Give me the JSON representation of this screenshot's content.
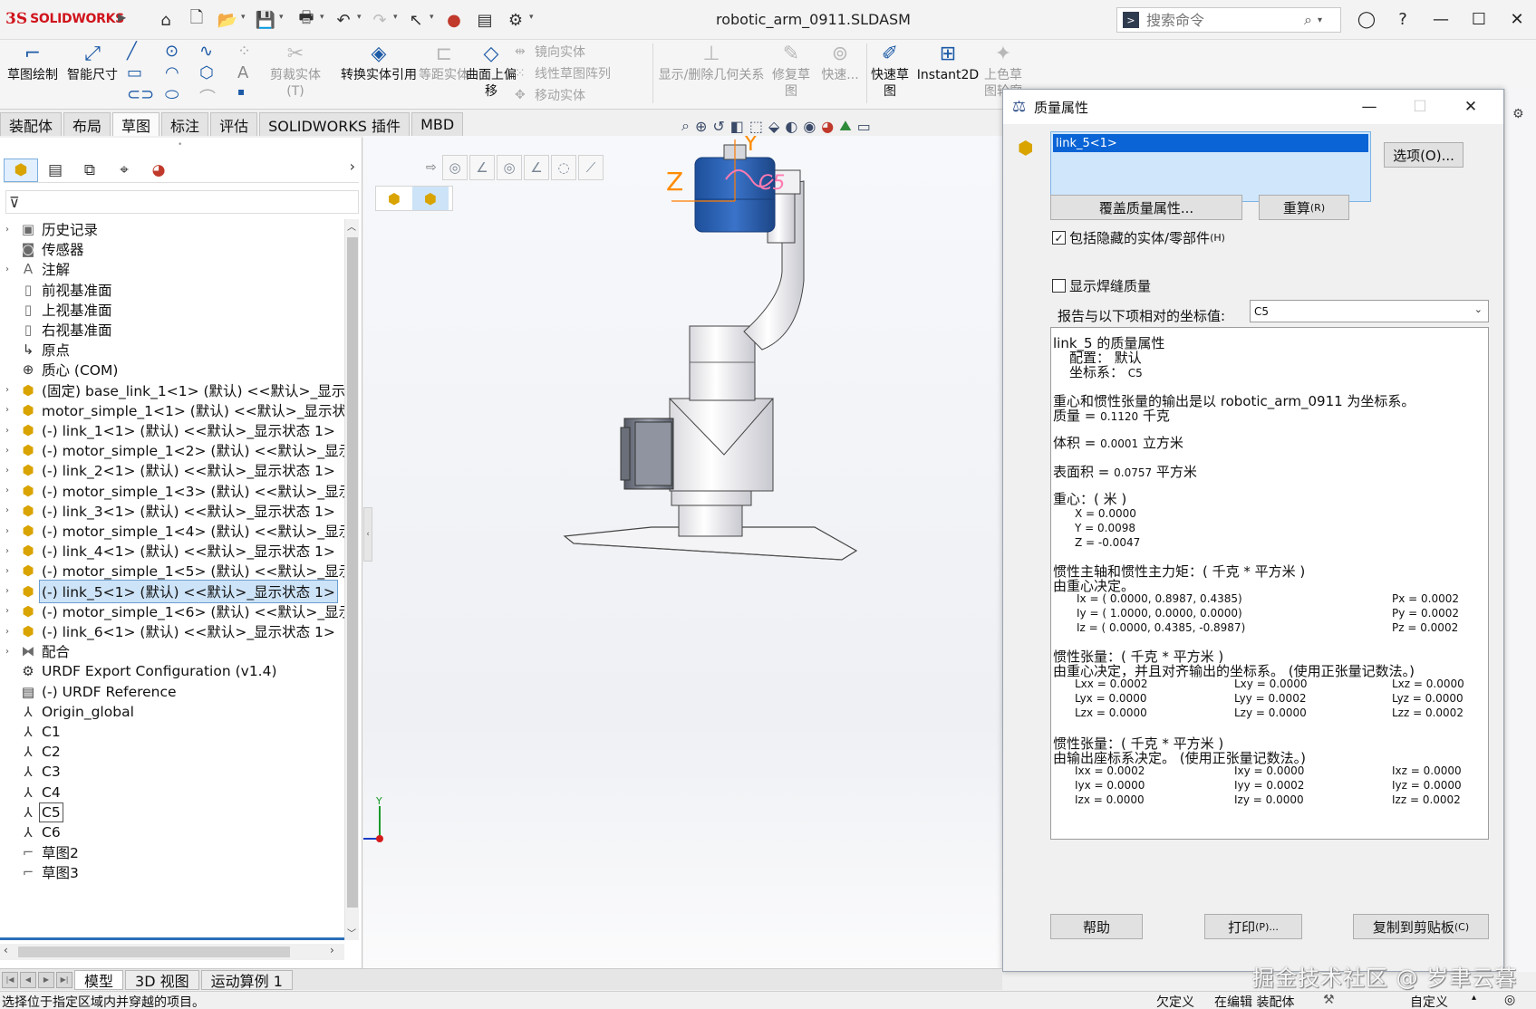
{
  "app": {
    "logo_prefix": "3S",
    "logo_text": "SOLIDWORKS",
    "document_title": "robotic_arm_0911.SLDASM",
    "search_placeholder": "搜索命令"
  },
  "ribbon": {
    "sketch": "草图绘制",
    "smart_dim": "智能尺寸",
    "trim": "剪裁实体(T)",
    "convert": "转换实体引用",
    "offset": "等距实体",
    "offset_surface": "曲面上偏移",
    "mirror": "镜向实体",
    "linear_pattern": "线性草图阵列",
    "move": "移动实体",
    "show_relations": "显示/删除几何关系",
    "repair": "修复草图",
    "quick_snaps": "快速...",
    "rapid_sketch": "快速草图",
    "instant2d": "Instant2D",
    "shaded_sketch": "上色草图轮廓"
  },
  "tabs": [
    "装配体",
    "布局",
    "草图",
    "标注",
    "评估",
    "SOLIDWORKS 插件",
    "MBD"
  ],
  "active_tab": "草图",
  "tree": [
    {
      "label": "历史记录",
      "exp": true,
      "icon": "history-icon"
    },
    {
      "label": "传感器",
      "exp": false,
      "icon": "sensor-icon"
    },
    {
      "label": "注解",
      "exp": true,
      "icon": "annotation-icon"
    },
    {
      "label": "前视基准面",
      "exp": false,
      "icon": "plane-icon"
    },
    {
      "label": "上视基准面",
      "exp": false,
      "icon": "plane-icon"
    },
    {
      "label": "右视基准面",
      "exp": false,
      "icon": "plane-icon"
    },
    {
      "label": "原点",
      "exp": false,
      "icon": "origin-icon"
    },
    {
      "label": "质心 (COM)",
      "exp": false,
      "icon": "com-icon"
    },
    {
      "label": "(固定) base_link_1<1> (默认) <<默认>_显示状态",
      "exp": true,
      "icon": "part-icon"
    },
    {
      "label": "motor_simple_1<1> (默认) <<默认>_显示状态",
      "exp": true,
      "icon": "part-icon"
    },
    {
      "label": "(-) link_1<1> (默认) <<默认>_显示状态 1>",
      "exp": true,
      "icon": "part-icon"
    },
    {
      "label": "(-) motor_simple_1<2> (默认) <<默认>_显示状",
      "exp": true,
      "icon": "part-icon"
    },
    {
      "label": "(-) link_2<1> (默认) <<默认>_显示状态 1>",
      "exp": true,
      "icon": "part-icon"
    },
    {
      "label": "(-) motor_simple_1<3> (默认) <<默认>_显示状",
      "exp": true,
      "icon": "part-icon"
    },
    {
      "label": "(-) link_3<1> (默认) <<默认>_显示状态 1>",
      "exp": true,
      "icon": "part-icon"
    },
    {
      "label": "(-) motor_simple_1<4> (默认) <<默认>_显示状",
      "exp": true,
      "icon": "part-icon"
    },
    {
      "label": "(-) link_4<1> (默认) <<默认>_显示状态 1>",
      "exp": true,
      "icon": "part-icon"
    },
    {
      "label": "(-) motor_simple_1<5> (默认) <<默认>_显示状",
      "exp": true,
      "icon": "part-icon"
    },
    {
      "label": "(-) link_5<1> (默认) <<默认>_显示状态 1>",
      "exp": true,
      "icon": "part-icon",
      "selected": true
    },
    {
      "label": "(-) motor_simple_1<6> (默认) <<默认>_显示状",
      "exp": true,
      "icon": "part-icon"
    },
    {
      "label": "(-) link_6<1> (默认) <<默认>_显示状态 1>",
      "exp": true,
      "icon": "part-icon"
    },
    {
      "label": "配合",
      "exp": true,
      "icon": "mates-icon"
    },
    {
      "label": "URDF Export Configuration (v1.4)",
      "exp": false,
      "icon": "urdf-config-icon"
    },
    {
      "label": "(-) URDF Reference",
      "exp": false,
      "icon": "3d-sketch-icon"
    },
    {
      "label": "Origin_global",
      "exp": false,
      "icon": "coord-system-icon"
    },
    {
      "label": "C1",
      "exp": false,
      "icon": "coord-system-icon"
    },
    {
      "label": "C2",
      "exp": false,
      "icon": "coord-system-icon"
    },
    {
      "label": "C3",
      "exp": false,
      "icon": "coord-system-icon"
    },
    {
      "label": "C4",
      "exp": false,
      "icon": "coord-system-icon"
    },
    {
      "label": "C5",
      "exp": false,
      "icon": "coord-system-icon",
      "boxed": true
    },
    {
      "label": "C6",
      "exp": false,
      "icon": "coord-system-icon"
    },
    {
      "label": "草图2",
      "exp": false,
      "icon": "sketch-icon"
    },
    {
      "label": "草图3",
      "exp": false,
      "icon": "sketch-icon"
    }
  ],
  "viewport": {
    "axis_y": "Y",
    "axis_z": "Z",
    "triad_y": "Y",
    "triad_z": "Z",
    "csys_label": "C5"
  },
  "dialog": {
    "title": "质量属性",
    "selected_item": "link_5<1>",
    "options_btn": "选项(O)...",
    "override_btn": "覆盖质量属性...",
    "recalc_btn": "重算",
    "recalc_key": "(R)",
    "include_hidden_label": "包括隐藏的实体/零部件",
    "include_hidden_key": "(H)",
    "include_hidden_checked": true,
    "show_weld_label": "显示焊缝质量",
    "show_weld_checked": false,
    "coord_label": "报告与以下项相对的坐标值:",
    "coord_value": "C5",
    "help_btn": "帮助",
    "print_btn": "打印",
    "print_key": "(P)...",
    "copy_btn": "复制到剪贴板",
    "copy_key": "(C)",
    "results": {
      "header": "link_5 的质量属性",
      "config_label": "配置： 默认",
      "coord_sys_label": "坐标系：",
      "coord_sys_value": "C5",
      "output_note": "重心和惯性张量的输出是以 robotic_arm_0911 为坐标系。",
      "mass_label": "质量 =",
      "mass_value": "0.1120",
      "mass_unit": "千克",
      "volume_label": "体积 =",
      "volume_value": "0.0001",
      "volume_unit": "立方米",
      "area_label": "表面积 =",
      "area_value": "0.0757",
      "area_unit": "平方米",
      "com_title": "重心：( 米 )",
      "com": [
        "X = 0.0000",
        "Y = 0.0098",
        "Z = -0.0047"
      ],
      "principal_title": "惯性主轴和惯性主力矩：( 千克 * 平方米 )",
      "principal_note": "由重心决定。",
      "principal_axes": [
        "Ix = ( 0.0000,  0.8987,  0.4385)",
        "Iy = ( 1.0000,  0.0000,  0.0000)",
        "Iz = ( 0.0000,  0.4385, -0.8987)"
      ],
      "principal_moments": [
        "Px = 0.0002",
        "Py = 0.0002",
        "Pz = 0.0002"
      ],
      "inertia_com_title": "惯性张量：( 千克 * 平方米 )",
      "inertia_com_note": "由重心决定，并且对齐输出的坐标系。 (使用正张量记数法。)",
      "inertia_com": [
        [
          "Lxx = 0.0002",
          "Lxy = 0.0000",
          "Lxz = 0.0000"
        ],
        [
          "Lyx = 0.0000",
          "Lyy = 0.0002",
          "Lyz = 0.0000"
        ],
        [
          "Lzx = 0.0000",
          "Lzy = 0.0000",
          "Lzz = 0.0002"
        ]
      ],
      "inertia_out_title": "惯性张量：( 千克 * 平方米 )",
      "inertia_out_note": "由输出座标系决定。 (使用正张量记数法。)",
      "inertia_out": [
        [
          "Ixx = 0.0002",
          "Ixy = 0.0000",
          "Ixz = 0.0000"
        ],
        [
          "Iyx = 0.0000",
          "Iyy = 0.0002",
          "Iyz = 0.0000"
        ],
        [
          "Izx = 0.0000",
          "Izy = 0.0000",
          "Izz = 0.0002"
        ]
      ]
    }
  },
  "bottom_tabs": [
    "模型",
    "3D 视图",
    "运动算例 1"
  ],
  "status": {
    "message": "选择位于指定区域内并穿越的项目。",
    "under_defined": "欠定义",
    "editing": "在编辑 装配体",
    "custom": "自定义"
  },
  "watermark": "掘金技术社区 @ 岁聿云暮"
}
